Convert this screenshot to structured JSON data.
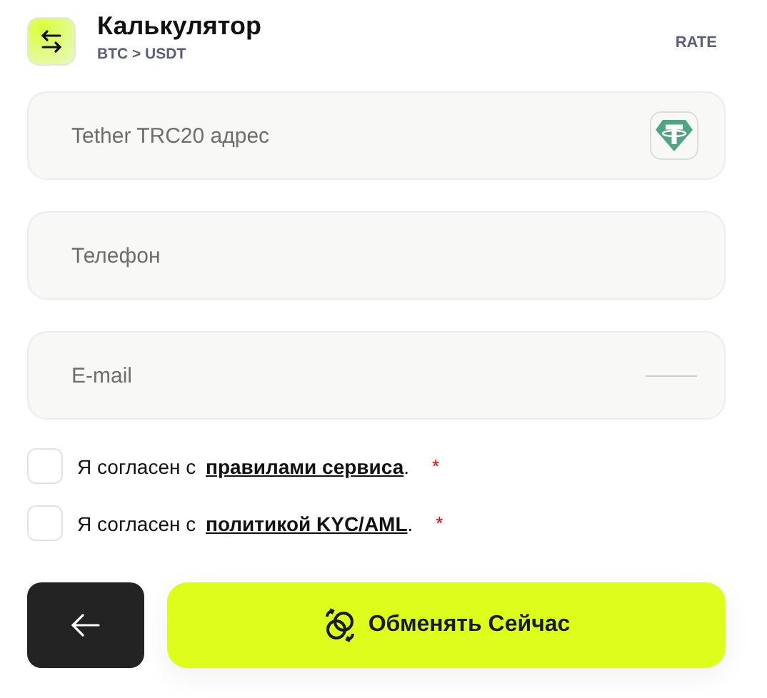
{
  "header": {
    "title": "Калькулятор",
    "subtitle": "BTC > USDT",
    "rate_label": "RATE"
  },
  "fields": [
    {
      "kind": "wallet",
      "placeholder": "Tether TRC20 адрес"
    },
    {
      "kind": "plain",
      "placeholder": "Телефон"
    },
    {
      "kind": "dash",
      "placeholder": "E-mail"
    }
  ],
  "consents": [
    {
      "prefix": "Я согласен с",
      "link": "правилами сервиса",
      "suffix": ".",
      "required": "*",
      "checked": false
    },
    {
      "prefix": "Я согласен с",
      "link": "политикой KYC/AML",
      "suffix": ".",
      "required": "*",
      "checked": false
    }
  ],
  "submit": {
    "label": "Обменять Сейчас"
  }
}
